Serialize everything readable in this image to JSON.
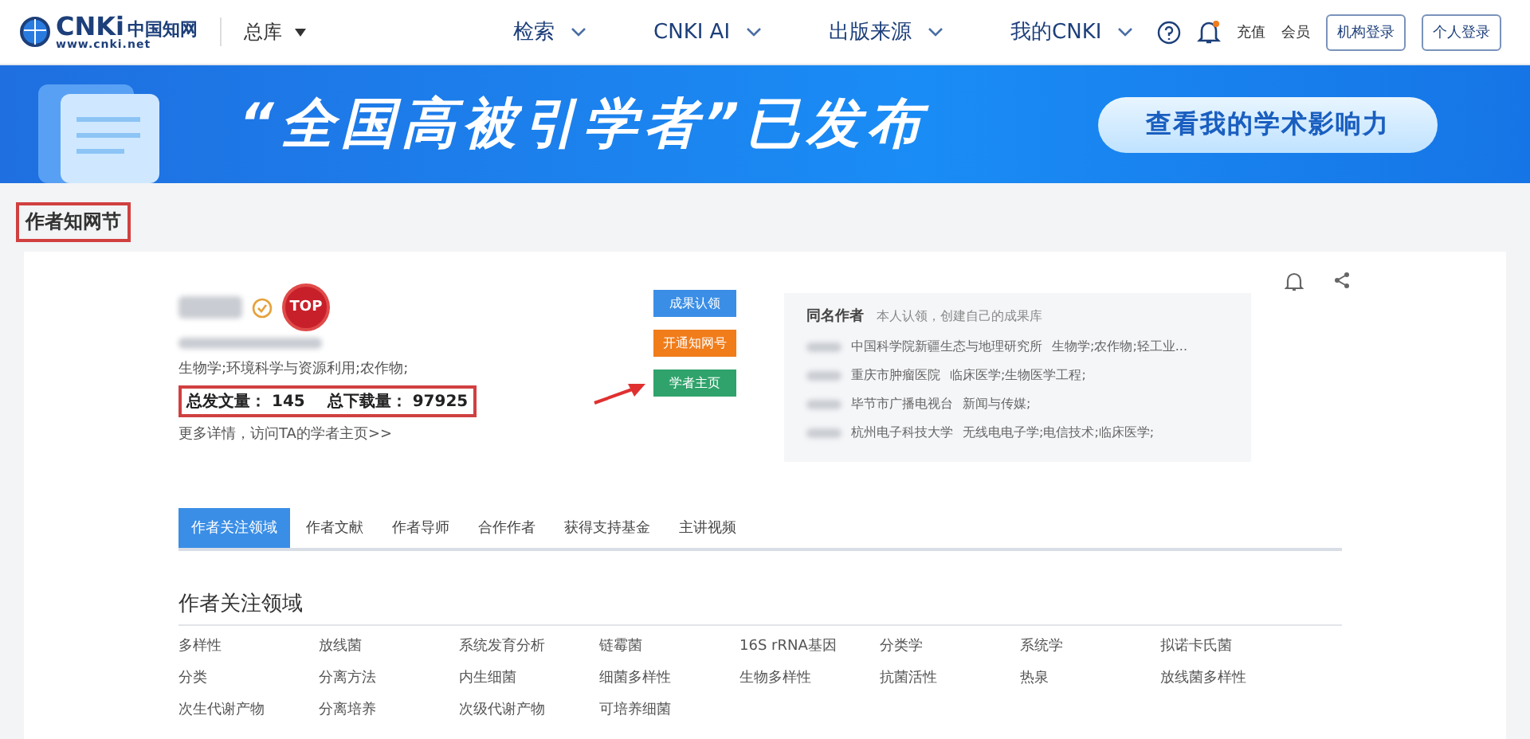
{
  "header": {
    "logo": {
      "brand": "CNKi",
      "cn": "中国知网",
      "url": "www.cnki.net"
    },
    "database": "总库",
    "nav": [
      {
        "label": "检索"
      },
      {
        "label": "CNKI AI"
      },
      {
        "label": "出版来源"
      },
      {
        "label": "我的CNKI"
      }
    ],
    "links": [
      "充值",
      "会员"
    ],
    "buttons": [
      "机构登录",
      "个人登录"
    ]
  },
  "banner": {
    "headline": "“全国高被引学者”已发布",
    "action": "查看我的学术影响力"
  },
  "section_title": "作者知网节",
  "profile": {
    "badge": "TOP",
    "fields": "生物学;环境科学与资源利用;农作物;",
    "stats": [
      {
        "label": "总发文量：",
        "value": "145"
      },
      {
        "label": "总下载量：",
        "value": "97925"
      }
    ],
    "more": "更多详情，访问TA的学者主页>>",
    "actions": [
      {
        "label": "成果认领",
        "color": "#3a8ee6"
      },
      {
        "label": "开通知网号",
        "color": "#f07c1a"
      },
      {
        "label": "学者主页",
        "color": "#2fa36b"
      }
    ]
  },
  "same_name": {
    "title": "同名作者",
    "hint": "本人认领，创建自己的成果库",
    "rows": [
      {
        "org": "中国科学院新疆生态与地理研究所",
        "fields": "生物学;农作物;轻工业..."
      },
      {
        "org": "重庆市肿瘤医院",
        "fields": "临床医学;生物医学工程;"
      },
      {
        "org": "毕节市广播电视台",
        "fields": "新闻与传媒;"
      },
      {
        "org": "杭州电子科技大学",
        "fields": "无线电电子学;电信技术;临床医学;"
      }
    ]
  },
  "tabs": [
    {
      "label": "作者关注领域",
      "selected": true
    },
    {
      "label": "作者文献",
      "selected": false
    },
    {
      "label": "作者导师",
      "selected": false
    },
    {
      "label": "合作作者",
      "selected": false
    },
    {
      "label": "获得支持基金",
      "selected": false
    },
    {
      "label": "主讲视频",
      "selected": false
    }
  ],
  "focus": {
    "title": "作者关注领域",
    "terms": [
      "多样性",
      "放线菌",
      "系统发育分析",
      "链霉菌",
      "16S rRNA基因",
      "分类学",
      "系统学",
      "拟诺卡氏菌",
      "分类",
      "分离方法",
      "内生细菌",
      "细菌多样性",
      "生物多样性",
      "抗菌活性",
      "热泉",
      "放线菌多样性",
      "次生代谢产物",
      "分离培养",
      "次级代谢产物",
      "可培养细菌"
    ]
  }
}
